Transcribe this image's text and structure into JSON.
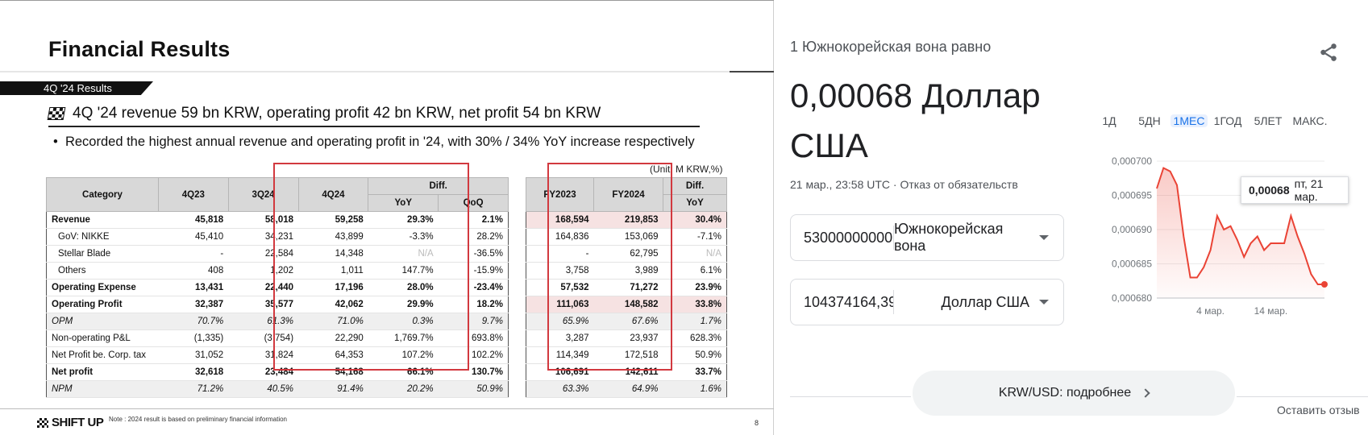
{
  "slide": {
    "title": "Financial Results",
    "ribbon": "4Q '24 Results",
    "headline": "4Q '24 revenue 59 bn KRW, operating profit 42 bn KRW, net profit 54 bn KRW",
    "bullet": "Recorded the highest annual revenue and operating profit in '24, with 30% / 34% YoY increase respectively",
    "unit": "(Unit: M KRW,%)",
    "table_main": {
      "headers": [
        "Category",
        "4Q23",
        "3Q24",
        "4Q24",
        "Diff.",
        "YoY",
        "QoQ"
      ],
      "rows": [
        {
          "label": "Revenue",
          "v": [
            "45,818",
            "58,018",
            "59,258",
            "29.3%",
            "2.1%"
          ]
        },
        {
          "label": "GoV: NIKKE",
          "v": [
            "45,410",
            "34,231",
            "43,899",
            "-3.3%",
            "28.2%"
          ]
        },
        {
          "label": "Stellar Blade",
          "v": [
            "-",
            "22,584",
            "14,348",
            "N/A",
            "-36.5%"
          ]
        },
        {
          "label": "Others",
          "v": [
            "408",
            "1,202",
            "1,011",
            "147.7%",
            "-15.9%"
          ]
        },
        {
          "label": "Operating Expense",
          "v": [
            "13,431",
            "22,440",
            "17,196",
            "28.0%",
            "-23.4%"
          ]
        },
        {
          "label": "Operating Profit",
          "v": [
            "32,387",
            "35,577",
            "42,062",
            "29.9%",
            "18.2%"
          ]
        },
        {
          "label": "OPM",
          "v": [
            "70.7%",
            "61.3%",
            "71.0%",
            "0.3%",
            "9.7%"
          ]
        },
        {
          "label": "Non-operating P&L",
          "v": [
            "(1,335)",
            "(3,754)",
            "22,290",
            "1,769.7%",
            "693.8%"
          ]
        },
        {
          "label": "Net Profit be. Corp. tax",
          "v": [
            "31,052",
            "31,824",
            "64,353",
            "107.2%",
            "102.2%"
          ]
        },
        {
          "label": "Net profit",
          "v": [
            "32,618",
            "23,484",
            "54,168",
            "66.1%",
            "130.7%"
          ]
        },
        {
          "label": "NPM",
          "v": [
            "71.2%",
            "40.5%",
            "91.4%",
            "20.2%",
            "50.9%"
          ]
        }
      ]
    },
    "table_fy": {
      "headers": [
        "FY2023",
        "FY2024",
        "Diff.",
        "YoY"
      ],
      "rows": [
        [
          "168,594",
          "219,853",
          "30.4%"
        ],
        [
          "164,836",
          "153,069",
          "-7.1%"
        ],
        [
          "-",
          "62,795",
          "N/A"
        ],
        [
          "3,758",
          "3,989",
          "6.1%"
        ],
        [
          "57,532",
          "71,272",
          "23.9%"
        ],
        [
          "111,063",
          "148,582",
          "33.8%"
        ],
        [
          "65.9%",
          "67.6%",
          "1.7%"
        ],
        [
          "3,287",
          "23,937",
          "628.3%"
        ],
        [
          "114,349",
          "172,518",
          "50.9%"
        ],
        [
          "106,691",
          "142,611",
          "33.7%"
        ],
        [
          "63.3%",
          "64.9%",
          "1.6%"
        ]
      ]
    },
    "footer_logo": "SHIFT UP",
    "footer_note": "Note : 2024 result is based on preliminary financial information",
    "page_number": "8"
  },
  "widget": {
    "top_line": "1 Южнокорейская вона равно",
    "big_value": "0,00068 Доллар США",
    "meta": "21 мар., 23:58 UTC · Отказ от обязательств",
    "from_amount": "53000000000",
    "from_currency": "Южнокорейская вона",
    "to_amount": "104374164,39",
    "to_currency": "Доллар США",
    "tabs": [
      "1Д",
      "5ДН",
      "1МЕС",
      "1ГОД",
      "5ЛЕТ",
      "МАКС."
    ],
    "active_tab": "1МЕС",
    "tooltip_value": "0,00068",
    "tooltip_date": "пт, 21 мар.",
    "more_button": "KRW/USD: подробнее",
    "feedback": "Оставить отзыв",
    "accent_color": "#ea4335"
  },
  "chart_data": {
    "type": "area",
    "ylim": [
      0.00068,
      0.0007
    ],
    "yticks": [
      "0,000700",
      "0,000695",
      "0,000690",
      "0,000685",
      "0,000680"
    ],
    "ytick_values": [
      0.0007,
      0.000695,
      0.00069,
      0.000685,
      0.00068
    ],
    "xtick_labels": [
      "4 мар.",
      "14 мар."
    ],
    "xtick_index": [
      8,
      17
    ],
    "series": [
      {
        "values": [
          0.000696,
          0.000699,
          0.0006985,
          0.0006965,
          0.000689,
          0.000683,
          0.000683,
          0.0006845,
          0.000687,
          0.000692,
          0.00069,
          0.0006905,
          0.0006885,
          0.000686,
          0.000688,
          0.000689,
          0.000687,
          0.000688,
          0.000688,
          0.000688,
          0.000692,
          0.000689,
          0.0006865,
          0.0006835,
          0.000682,
          0.000682
        ]
      }
    ]
  }
}
